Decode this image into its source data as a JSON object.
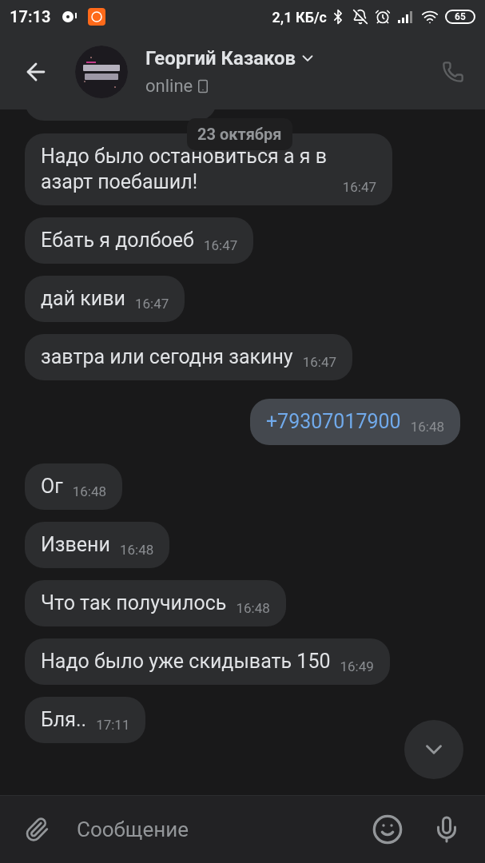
{
  "status_bar": {
    "time": "17:13",
    "speed": "2,1 КБ/с",
    "battery": "65"
  },
  "header": {
    "name": "Георгий Казаков",
    "status": "online"
  },
  "date_badge": "23 октября",
  "messages": [
    {
      "text": "Надо было остановиться а я в азарт поебашил!",
      "time": "16:47",
      "outgoing": false,
      "link": false
    },
    {
      "text": "Ебать я долбоеб",
      "time": "16:47",
      "outgoing": false,
      "link": false
    },
    {
      "text": "дай киви",
      "time": "16:47",
      "outgoing": false,
      "link": false
    },
    {
      "text": "завтра или сегодня закину",
      "time": "16:47",
      "outgoing": false,
      "link": false
    },
    {
      "text": "+79307017900",
      "time": "16:48",
      "outgoing": true,
      "link": true
    },
    {
      "text": "Ог",
      "time": "16:48",
      "outgoing": false,
      "link": false
    },
    {
      "text": "Извени",
      "time": "16:48",
      "outgoing": false,
      "link": false
    },
    {
      "text": "Что так получилось",
      "time": "16:48",
      "outgoing": false,
      "link": false
    },
    {
      "text": "Надо было уже скидывать 150",
      "time": "16:49",
      "outgoing": false,
      "link": false
    },
    {
      "text": "Бля..",
      "time": "17:11",
      "outgoing": false,
      "link": false
    }
  ],
  "composer": {
    "placeholder": "Сообщение"
  }
}
